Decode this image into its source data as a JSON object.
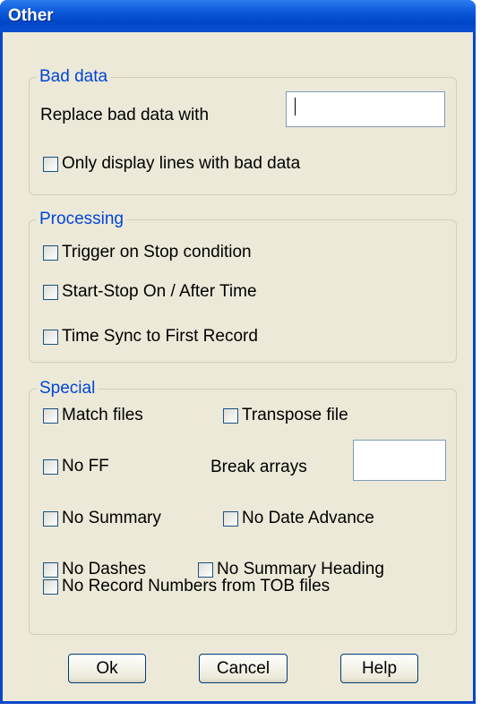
{
  "window": {
    "title": "Other"
  },
  "bad_data": {
    "legend": "Bad data",
    "replace_label": "Replace bad data with",
    "replace_value": "",
    "only_display_label": "Only display lines with bad data"
  },
  "processing": {
    "legend": "Processing",
    "trigger_label": "Trigger on Stop condition",
    "start_stop_label": "Start-Stop  On / After Time",
    "time_sync_label": "Time Sync to First Record"
  },
  "special": {
    "legend": "Special",
    "match_files_label": "Match files",
    "transpose_label": "Transpose file",
    "no_ff_label": "No FF",
    "break_arrays_label": "Break arrays",
    "break_arrays_value": "",
    "no_summary_label": "No Summary",
    "no_date_advance_label": "No Date Advance",
    "no_dashes_label": "No Dashes",
    "no_summary_heading_label": "No Summary Heading",
    "no_record_numbers_label": "No Record Numbers from TOB files"
  },
  "buttons": {
    "ok": "Ok",
    "cancel": "Cancel",
    "help": "Help"
  }
}
